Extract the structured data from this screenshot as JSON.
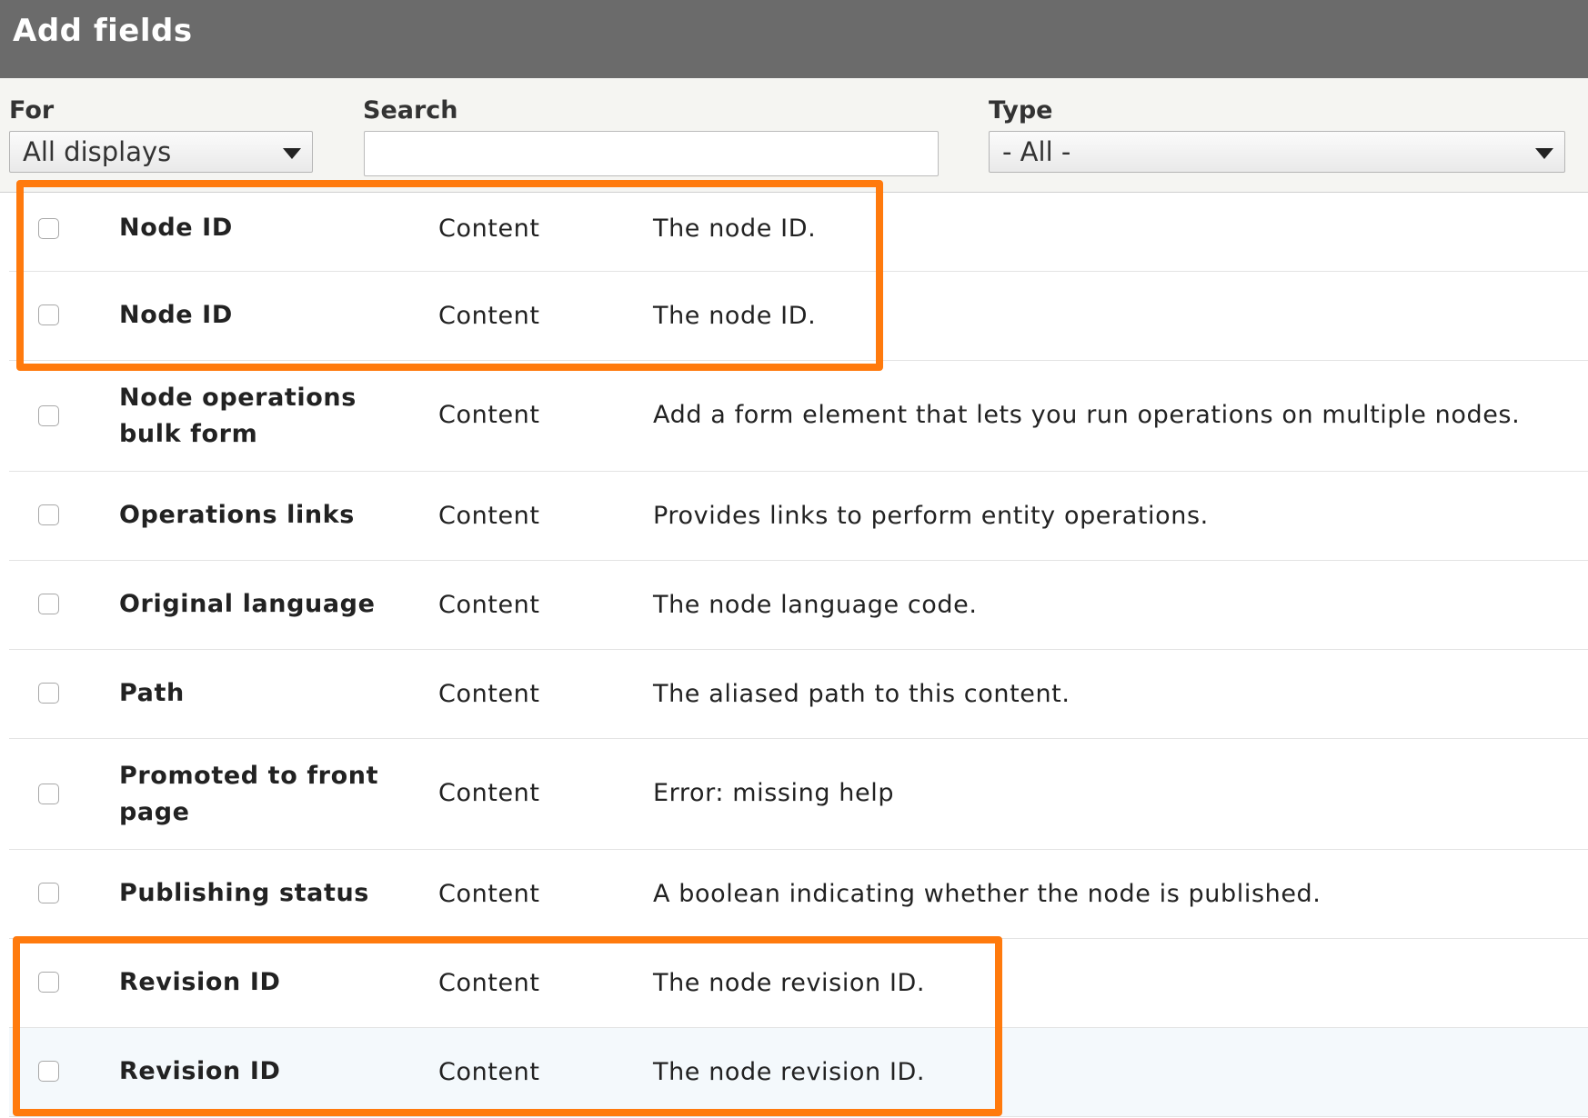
{
  "dialog": {
    "title": "Add fields"
  },
  "filters": {
    "for_label": "For",
    "for_value": "All displays",
    "search_label": "Search",
    "search_value": "",
    "type_label": "Type",
    "type_value": "- All -"
  },
  "rows": [
    {
      "name": "Node ID",
      "category": "Content",
      "description": "The node ID.",
      "checked": false
    },
    {
      "name": "Node ID",
      "category": "Content",
      "description": "The node ID.",
      "checked": false
    },
    {
      "name": "Node operations bulk form",
      "category": "Content",
      "description": "Add a form element that lets you run operations on multiple nodes.",
      "checked": false
    },
    {
      "name": "Operations links",
      "category": "Content",
      "description": "Provides links to perform entity operations.",
      "checked": false
    },
    {
      "name": "Original language",
      "category": "Content",
      "description": "The node language code.",
      "checked": false
    },
    {
      "name": "Path",
      "category": "Content",
      "description": "The aliased path to this content.",
      "checked": false
    },
    {
      "name": "Promoted to front page",
      "category": "Content",
      "description": "Error: missing help",
      "checked": false
    },
    {
      "name": "Publishing status",
      "category": "Content",
      "description": "A boolean indicating whether the node is published.",
      "checked": false
    },
    {
      "name": "Revision ID",
      "category": "Content",
      "description": "The node revision ID.",
      "checked": false
    },
    {
      "name": "Revision ID",
      "category": "Content",
      "description": "The node revision ID.",
      "checked": false
    }
  ],
  "colors": {
    "titlebar": "#6b6b6b",
    "highlight_box": "#ff7a0d",
    "row_hover": "#f4f9fc"
  }
}
